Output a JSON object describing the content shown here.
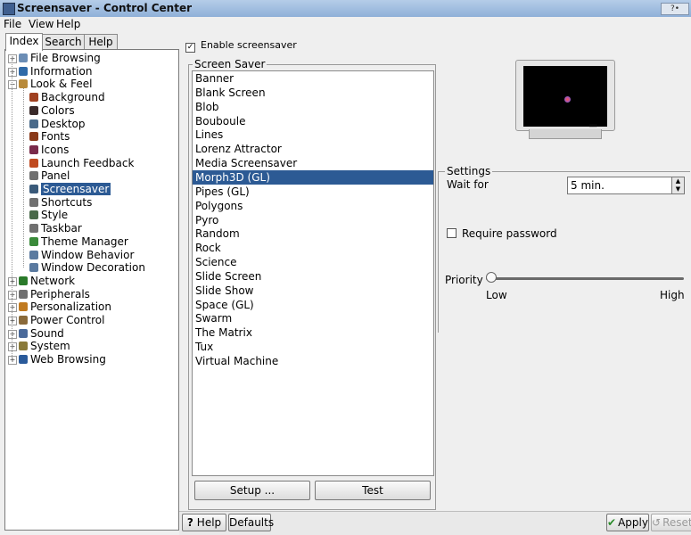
{
  "window": {
    "title": "Screensaver - Control Center",
    "buttons_label": "?•"
  },
  "menu": [
    "File",
    "View",
    "Help"
  ],
  "tabs": [
    "Index",
    "Search",
    "Help"
  ],
  "tree": [
    {
      "label": "File Browsing",
      "level": 0,
      "expander": "+",
      "icon": "folder-icon",
      "color": "#6b8db5"
    },
    {
      "label": "Information",
      "level": 0,
      "expander": "+",
      "icon": "info-icon",
      "color": "#2f6aa8"
    },
    {
      "label": "Look & Feel",
      "level": 0,
      "expander": "−",
      "icon": "brush-icon",
      "color": "#b88a3a"
    },
    {
      "label": "Background",
      "level": 1,
      "icon": "background-icon",
      "color": "#a04020"
    },
    {
      "label": "Colors",
      "level": 1,
      "icon": "palette-icon",
      "color": "#3a2a2a"
    },
    {
      "label": "Desktop",
      "level": 1,
      "icon": "desktop-icon",
      "color": "#4a6a8a"
    },
    {
      "label": "Fonts",
      "level": 1,
      "icon": "font-icon",
      "color": "#8a3a1a"
    },
    {
      "label": "Icons",
      "level": 1,
      "icon": "icons-icon",
      "color": "#7a2a4a"
    },
    {
      "label": "Launch Feedback",
      "level": 1,
      "icon": "rocket-icon",
      "color": "#c04a20"
    },
    {
      "label": "Panel",
      "level": 1,
      "icon": "panel-icon",
      "color": "#707070"
    },
    {
      "label": "Screensaver",
      "level": 1,
      "icon": "screensaver-icon",
      "color": "#3a5a7a",
      "selected": true
    },
    {
      "label": "Shortcuts",
      "level": 1,
      "icon": "keyboard-icon",
      "color": "#707070"
    },
    {
      "label": "Style",
      "level": 1,
      "icon": "style-icon",
      "color": "#4a6a4a"
    },
    {
      "label": "Taskbar",
      "level": 1,
      "icon": "taskbar-icon",
      "color": "#707070"
    },
    {
      "label": "Theme Manager",
      "level": 1,
      "icon": "theme-icon",
      "color": "#3a8a3a"
    },
    {
      "label": "Window Behavior",
      "level": 1,
      "icon": "window-icon",
      "color": "#5a7aa0"
    },
    {
      "label": "Window Decoration",
      "level": 1,
      "icon": "window-deco-icon",
      "color": "#5a7aa0"
    },
    {
      "label": "Network",
      "level": 0,
      "expander": "+",
      "icon": "globe-icon",
      "color": "#2a7a2a"
    },
    {
      "label": "Peripherals",
      "level": 0,
      "expander": "+",
      "icon": "mouse-icon",
      "color": "#707070"
    },
    {
      "label": "Personalization",
      "level": 0,
      "expander": "+",
      "icon": "person-icon",
      "color": "#c07a20"
    },
    {
      "label": "Power Control",
      "level": 0,
      "expander": "+",
      "icon": "power-icon",
      "color": "#8a6a3a"
    },
    {
      "label": "Sound",
      "level": 0,
      "expander": "+",
      "icon": "speaker-icon",
      "color": "#4a6a9a"
    },
    {
      "label": "System",
      "level": 0,
      "expander": "+",
      "icon": "wrench-icon",
      "color": "#8a7a3a"
    },
    {
      "label": "Web Browsing",
      "level": 0,
      "expander": "+",
      "icon": "web-icon",
      "color": "#2a5a9a"
    }
  ],
  "enable_screensaver": {
    "label": "Enable screensaver",
    "checked": true
  },
  "screensaver_group": {
    "title": "Screen Saver",
    "items": [
      "Banner",
      "Blank Screen",
      "Blob",
      "Bouboule",
      "Lines",
      "Lorenz Attractor",
      "Media Screensaver",
      "Morph3D (GL)",
      "Pipes (GL)",
      "Polygons",
      "Pyro",
      "Random",
      "Rock",
      "Science",
      "Slide Screen",
      "Slide Show",
      "Space (GL)",
      "Swarm",
      "The Matrix",
      "Tux",
      "Virtual Machine"
    ],
    "selected": "Morph3D (GL)",
    "setup_label": "Setup ...",
    "test_label": "Test"
  },
  "settings": {
    "title": "Settings",
    "wait_label": "Wait for",
    "wait_value": "5 min.",
    "require_password_label": "Require password",
    "require_password_checked": false,
    "priority_label": "Priority",
    "priority_value": 0,
    "low_label": "Low",
    "high_label": "High"
  },
  "bottom": {
    "help_label": "Help",
    "help_glyph": "?",
    "defaults_label": "Defaults",
    "apply_label": "Apply",
    "reset_label": "Reset"
  },
  "colors": {
    "selection": "#2c5a94",
    "titlebar": "#8fb0d8"
  }
}
